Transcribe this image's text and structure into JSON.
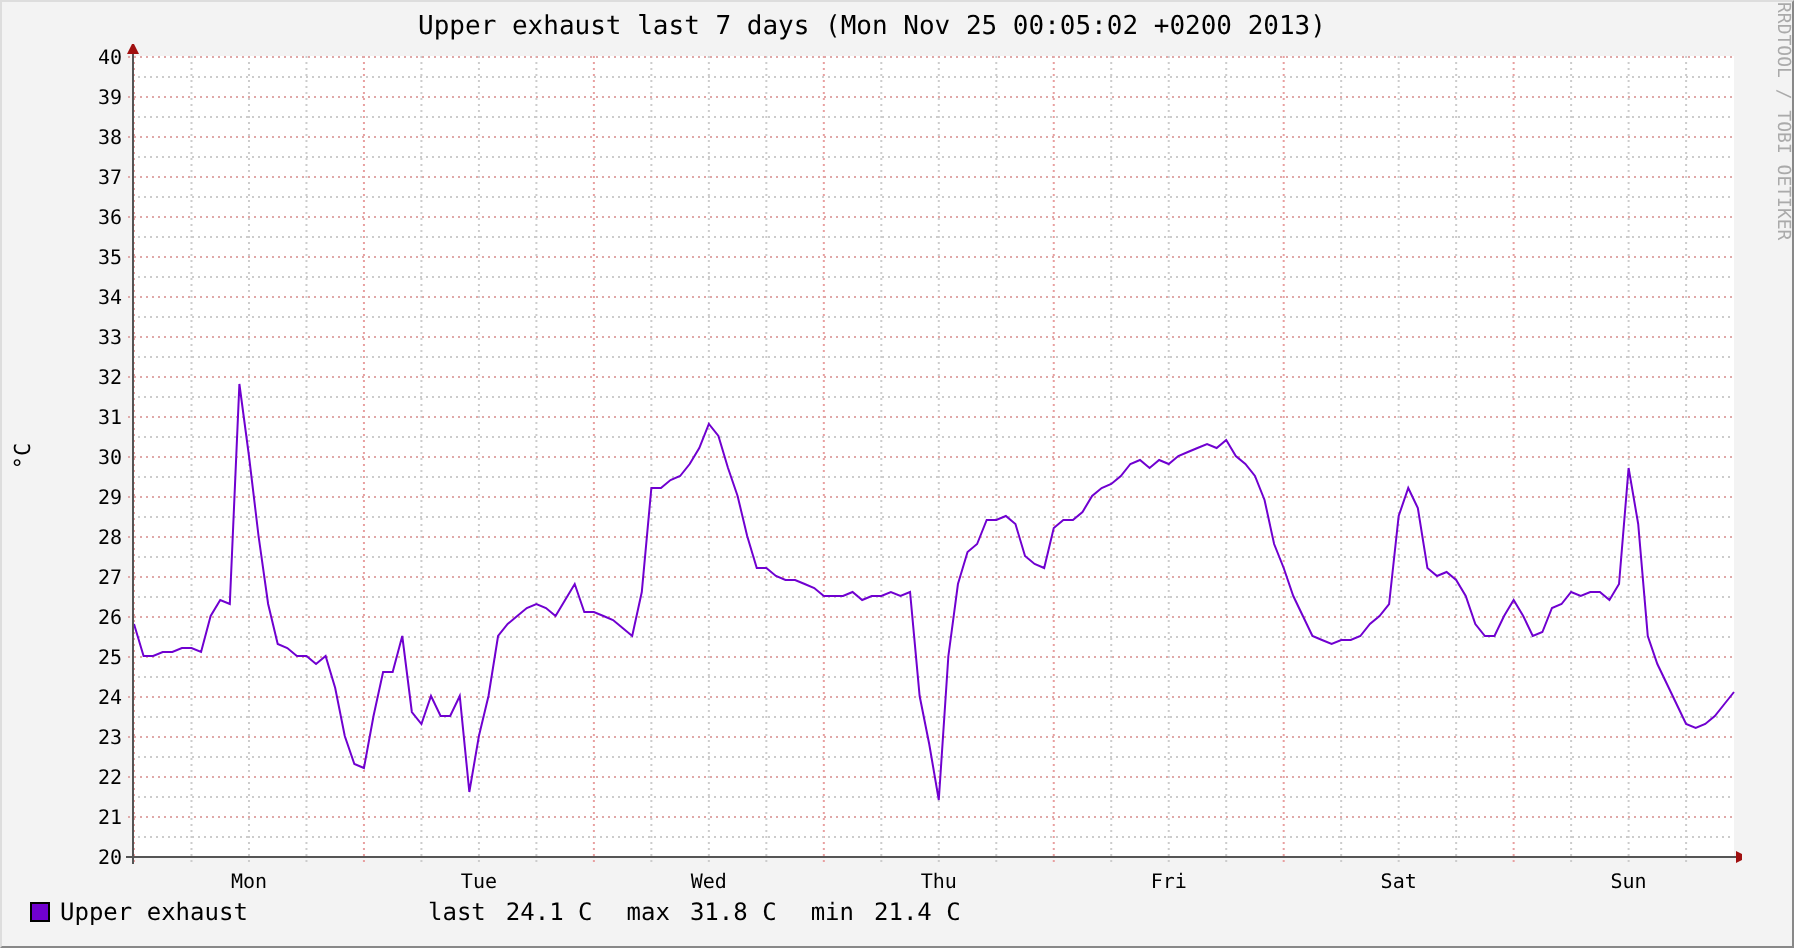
{
  "title": "Upper exhaust last 7 days (Mon Nov 25 00:05:02 +0200 2013)",
  "side_text": "RRDTOOL / TOBI OETIKER",
  "chart_data": {
    "type": "line",
    "grid": true,
    "ylabel": "°C",
    "ylim": [
      20,
      40
    ],
    "yticks": [
      20,
      21,
      22,
      23,
      24,
      25,
      26,
      27,
      28,
      29,
      30,
      31,
      32,
      33,
      34,
      35,
      36,
      37,
      38,
      39,
      40
    ],
    "categories": [
      null,
      null,
      null,
      null,
      null,
      null,
      null,
      null,
      null,
      null,
      null,
      null,
      "Mon",
      null,
      null,
      null,
      null,
      null,
      null,
      null,
      null,
      null,
      null,
      null,
      null,
      null,
      null,
      null,
      null,
      null,
      null,
      null,
      null,
      null,
      null,
      null,
      "Tue",
      null,
      null,
      null,
      null,
      null,
      null,
      null,
      null,
      null,
      null,
      null,
      null,
      null,
      null,
      null,
      null,
      null,
      null,
      null,
      null,
      null,
      null,
      null,
      "Wed",
      null,
      null,
      null,
      null,
      null,
      null,
      null,
      null,
      null,
      null,
      null,
      null,
      null,
      null,
      null,
      null,
      null,
      null,
      null,
      null,
      null,
      null,
      null,
      "Thu",
      null,
      null,
      null,
      null,
      null,
      null,
      null,
      null,
      null,
      null,
      null,
      null,
      null,
      null,
      null,
      null,
      null,
      null,
      null,
      null,
      null,
      null,
      null,
      "Fri",
      null,
      null,
      null,
      null,
      null,
      null,
      null,
      null,
      null,
      null,
      null,
      null,
      null,
      null,
      null,
      null,
      null,
      null,
      null,
      null,
      null,
      null,
      null,
      "Sat",
      null,
      null,
      null,
      null,
      null,
      null,
      null,
      null,
      null,
      null,
      null,
      null,
      null,
      null,
      null,
      null,
      null,
      null,
      null,
      null,
      null,
      null,
      null,
      "Sun",
      null,
      null,
      null,
      null,
      null,
      null,
      null,
      null,
      null,
      null,
      null
    ],
    "series": [
      {
        "name": "Upper exhaust",
        "color": "#7000d0",
        "values": [
          25.8,
          25.0,
          25.0,
          25.1,
          25.1,
          25.2,
          25.2,
          25.1,
          26.0,
          26.4,
          26.3,
          31.8,
          30.0,
          28.0,
          26.3,
          25.3,
          25.2,
          25.0,
          25.0,
          24.8,
          25.0,
          24.2,
          23.0,
          22.3,
          22.2,
          23.5,
          24.6,
          24.6,
          25.5,
          23.6,
          23.3,
          24.0,
          23.5,
          23.5,
          24.0,
          21.6,
          23.0,
          24.0,
          25.5,
          25.8,
          26.0,
          26.2,
          26.3,
          26.2,
          26.0,
          26.4,
          26.8,
          26.1,
          26.1,
          26.0,
          25.9,
          25.7,
          25.5,
          26.6,
          29.2,
          29.2,
          29.4,
          29.5,
          29.8,
          30.2,
          30.8,
          30.5,
          29.7,
          29.0,
          28.0,
          27.2,
          27.2,
          27.0,
          26.9,
          26.9,
          26.8,
          26.7,
          26.5,
          26.5,
          26.5,
          26.6,
          26.4,
          26.5,
          26.5,
          26.6,
          26.5,
          26.6,
          24.0,
          22.8,
          21.4,
          25.0,
          26.8,
          27.6,
          27.8,
          28.4,
          28.4,
          28.5,
          28.3,
          27.5,
          27.3,
          27.2,
          28.2,
          28.4,
          28.4,
          28.6,
          29.0,
          29.2,
          29.3,
          29.5,
          29.8,
          29.9,
          29.7,
          29.9,
          29.8,
          30.0,
          30.1,
          30.2,
          30.3,
          30.2,
          30.4,
          30.0,
          29.8,
          29.5,
          28.9,
          27.8,
          27.2,
          26.5,
          26.0,
          25.5,
          25.4,
          25.3,
          25.4,
          25.4,
          25.5,
          25.8,
          26.0,
          26.3,
          28.5,
          29.2,
          28.7,
          27.2,
          27.0,
          27.1,
          26.9,
          26.5,
          25.8,
          25.5,
          25.5,
          26.0,
          26.4,
          26.0,
          25.5,
          25.6,
          26.2,
          26.3,
          26.6,
          26.5,
          26.6,
          26.6,
          26.4,
          26.8,
          29.7,
          28.3,
          25.5,
          24.8,
          24.3,
          23.8,
          23.3,
          23.2,
          23.3,
          23.5,
          23.8,
          24.1
        ]
      }
    ]
  },
  "legend_stats": [
    {
      "label": "last",
      "value": "24.1 C"
    },
    {
      "label": "max",
      "value": "31.8 C"
    },
    {
      "label": "min",
      "value": "21.4 C"
    }
  ]
}
